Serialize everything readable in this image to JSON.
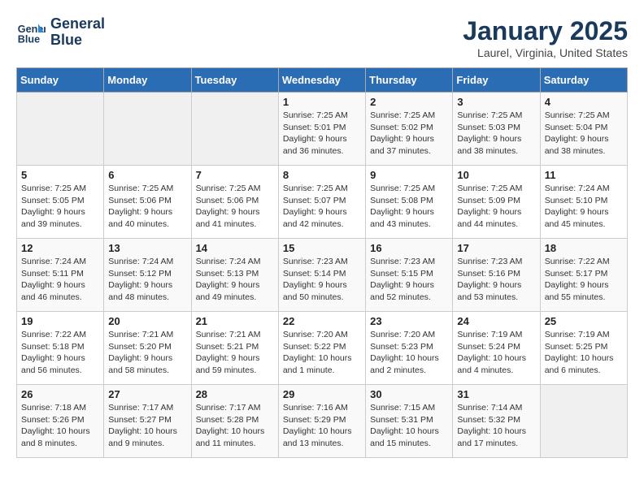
{
  "header": {
    "logo_line1": "General",
    "logo_line2": "Blue",
    "month_title": "January 2025",
    "location": "Laurel, Virginia, United States"
  },
  "days_of_week": [
    "Sunday",
    "Monday",
    "Tuesday",
    "Wednesday",
    "Thursday",
    "Friday",
    "Saturday"
  ],
  "weeks": [
    [
      {
        "day": "",
        "info": ""
      },
      {
        "day": "",
        "info": ""
      },
      {
        "day": "",
        "info": ""
      },
      {
        "day": "1",
        "info": "Sunrise: 7:25 AM\nSunset: 5:01 PM\nDaylight: 9 hours\nand 36 minutes."
      },
      {
        "day": "2",
        "info": "Sunrise: 7:25 AM\nSunset: 5:02 PM\nDaylight: 9 hours\nand 37 minutes."
      },
      {
        "day": "3",
        "info": "Sunrise: 7:25 AM\nSunset: 5:03 PM\nDaylight: 9 hours\nand 38 minutes."
      },
      {
        "day": "4",
        "info": "Sunrise: 7:25 AM\nSunset: 5:04 PM\nDaylight: 9 hours\nand 38 minutes."
      }
    ],
    [
      {
        "day": "5",
        "info": "Sunrise: 7:25 AM\nSunset: 5:05 PM\nDaylight: 9 hours\nand 39 minutes."
      },
      {
        "day": "6",
        "info": "Sunrise: 7:25 AM\nSunset: 5:06 PM\nDaylight: 9 hours\nand 40 minutes."
      },
      {
        "day": "7",
        "info": "Sunrise: 7:25 AM\nSunset: 5:06 PM\nDaylight: 9 hours\nand 41 minutes."
      },
      {
        "day": "8",
        "info": "Sunrise: 7:25 AM\nSunset: 5:07 PM\nDaylight: 9 hours\nand 42 minutes."
      },
      {
        "day": "9",
        "info": "Sunrise: 7:25 AM\nSunset: 5:08 PM\nDaylight: 9 hours\nand 43 minutes."
      },
      {
        "day": "10",
        "info": "Sunrise: 7:25 AM\nSunset: 5:09 PM\nDaylight: 9 hours\nand 44 minutes."
      },
      {
        "day": "11",
        "info": "Sunrise: 7:24 AM\nSunset: 5:10 PM\nDaylight: 9 hours\nand 45 minutes."
      }
    ],
    [
      {
        "day": "12",
        "info": "Sunrise: 7:24 AM\nSunset: 5:11 PM\nDaylight: 9 hours\nand 46 minutes."
      },
      {
        "day": "13",
        "info": "Sunrise: 7:24 AM\nSunset: 5:12 PM\nDaylight: 9 hours\nand 48 minutes."
      },
      {
        "day": "14",
        "info": "Sunrise: 7:24 AM\nSunset: 5:13 PM\nDaylight: 9 hours\nand 49 minutes."
      },
      {
        "day": "15",
        "info": "Sunrise: 7:23 AM\nSunset: 5:14 PM\nDaylight: 9 hours\nand 50 minutes."
      },
      {
        "day": "16",
        "info": "Sunrise: 7:23 AM\nSunset: 5:15 PM\nDaylight: 9 hours\nand 52 minutes."
      },
      {
        "day": "17",
        "info": "Sunrise: 7:23 AM\nSunset: 5:16 PM\nDaylight: 9 hours\nand 53 minutes."
      },
      {
        "day": "18",
        "info": "Sunrise: 7:22 AM\nSunset: 5:17 PM\nDaylight: 9 hours\nand 55 minutes."
      }
    ],
    [
      {
        "day": "19",
        "info": "Sunrise: 7:22 AM\nSunset: 5:18 PM\nDaylight: 9 hours\nand 56 minutes."
      },
      {
        "day": "20",
        "info": "Sunrise: 7:21 AM\nSunset: 5:20 PM\nDaylight: 9 hours\nand 58 minutes."
      },
      {
        "day": "21",
        "info": "Sunrise: 7:21 AM\nSunset: 5:21 PM\nDaylight: 9 hours\nand 59 minutes."
      },
      {
        "day": "22",
        "info": "Sunrise: 7:20 AM\nSunset: 5:22 PM\nDaylight: 10 hours\nand 1 minute."
      },
      {
        "day": "23",
        "info": "Sunrise: 7:20 AM\nSunset: 5:23 PM\nDaylight: 10 hours\nand 2 minutes."
      },
      {
        "day": "24",
        "info": "Sunrise: 7:19 AM\nSunset: 5:24 PM\nDaylight: 10 hours\nand 4 minutes."
      },
      {
        "day": "25",
        "info": "Sunrise: 7:19 AM\nSunset: 5:25 PM\nDaylight: 10 hours\nand 6 minutes."
      }
    ],
    [
      {
        "day": "26",
        "info": "Sunrise: 7:18 AM\nSunset: 5:26 PM\nDaylight: 10 hours\nand 8 minutes."
      },
      {
        "day": "27",
        "info": "Sunrise: 7:17 AM\nSunset: 5:27 PM\nDaylight: 10 hours\nand 9 minutes."
      },
      {
        "day": "28",
        "info": "Sunrise: 7:17 AM\nSunset: 5:28 PM\nDaylight: 10 hours\nand 11 minutes."
      },
      {
        "day": "29",
        "info": "Sunrise: 7:16 AM\nSunset: 5:29 PM\nDaylight: 10 hours\nand 13 minutes."
      },
      {
        "day": "30",
        "info": "Sunrise: 7:15 AM\nSunset: 5:31 PM\nDaylight: 10 hours\nand 15 minutes."
      },
      {
        "day": "31",
        "info": "Sunrise: 7:14 AM\nSunset: 5:32 PM\nDaylight: 10 hours\nand 17 minutes."
      },
      {
        "day": "",
        "info": ""
      }
    ]
  ]
}
